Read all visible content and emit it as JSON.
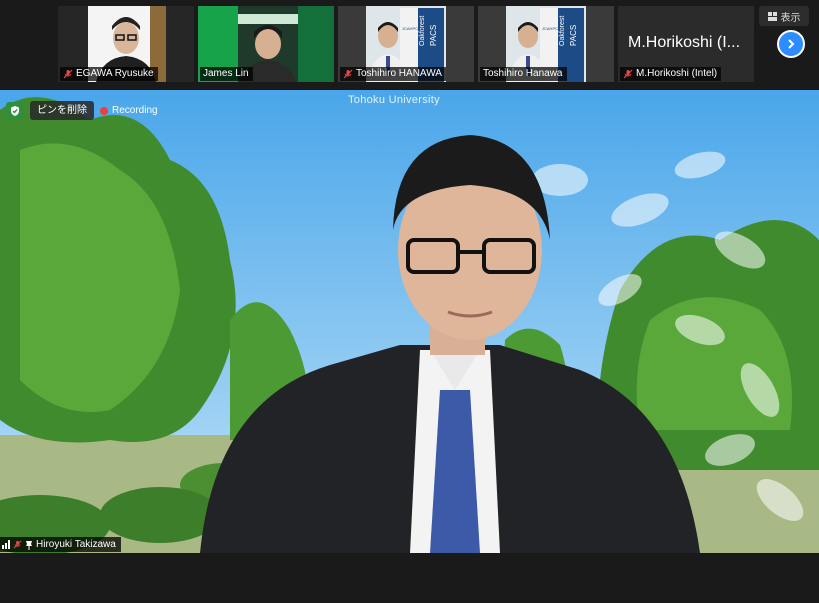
{
  "participants": [
    {
      "name": "EGAWA Ryusuke",
      "muted": true
    },
    {
      "name": "James Lin",
      "muted": false
    },
    {
      "name": "Toshihiro HANAWA",
      "muted": true
    },
    {
      "name": "Toshihiro Hanawa",
      "muted": false
    },
    {
      "name": "M.Horikoshi (Intel)",
      "display_name": "M.Horikoshi (I...",
      "muted": true
    }
  ],
  "banner": {
    "left": "Oakforest",
    "right": "PACS",
    "logo": "JCAHPC"
  },
  "controls": {
    "view_label": "表示",
    "view_icon": "grid-icon",
    "next_icon": "chevron-right-icon"
  },
  "main": {
    "background_text": "Tohoku University",
    "unpin_label": "ピンを削除",
    "recording_label": "Recording",
    "speaker_name": "Hiroyuki Takizawa"
  },
  "colors": {
    "accent": "#2d8cff",
    "recording": "#e8413f",
    "shield": "#2f8f3a"
  }
}
